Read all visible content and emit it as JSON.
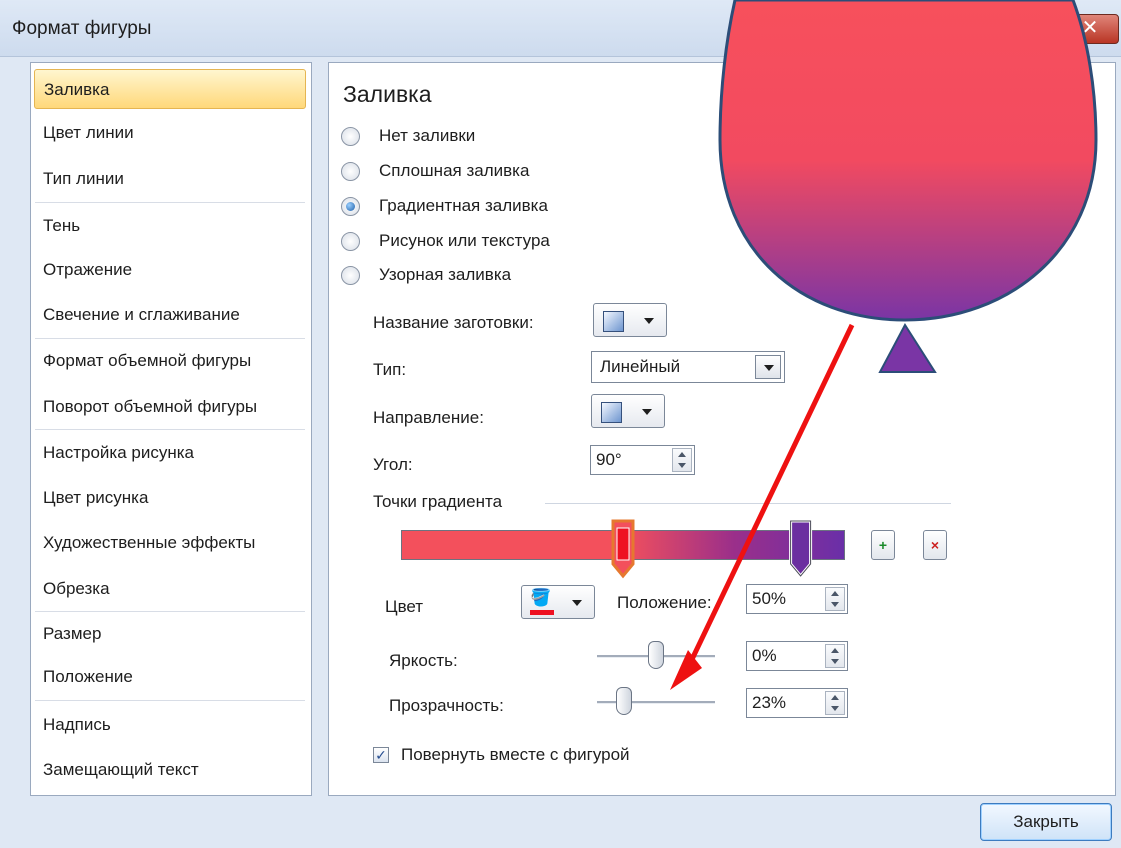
{
  "window": {
    "title": "Формат фигуры",
    "help_label": "?",
    "close_label": "✕"
  },
  "sidebar": {
    "items": [
      {
        "label": "Заливка"
      },
      {
        "label": "Цвет линии"
      },
      {
        "label": "Тип линии"
      },
      {
        "label": "Тень"
      },
      {
        "label": "Отражение"
      },
      {
        "label": "Свечение и сглаживание"
      },
      {
        "label": "Формат объемной фигуры"
      },
      {
        "label": "Поворот объемной фигуры"
      },
      {
        "label": "Настройка рисунка"
      },
      {
        "label": "Цвет рисунка"
      },
      {
        "label": "Художественные эффекты"
      },
      {
        "label": "Обрезка"
      },
      {
        "label": "Размер"
      },
      {
        "label": "Положение"
      },
      {
        "label": "Надпись"
      },
      {
        "label": "Замещающий текст"
      }
    ],
    "selected": "Заливка"
  },
  "fill": {
    "title": "Заливка",
    "options": [
      {
        "label": "Нет заливки",
        "selected": false
      },
      {
        "label": "Сплошная заливка",
        "selected": false
      },
      {
        "label": "Градиентная заливка",
        "selected": true
      },
      {
        "label": "Рисунок или текстура",
        "selected": false
      },
      {
        "label": "Узорная заливка",
        "selected": false
      }
    ],
    "preset_label": "Название заготовки:",
    "type_label": "Тип:",
    "type_value": "Линейный",
    "direction_label": "Направление:",
    "angle_label": "Угол:",
    "angle_value": "90°",
    "stops_label": "Точки градиента",
    "stops": [
      {
        "position": 0.5,
        "color": "#f3505c",
        "selected": true
      },
      {
        "position": 0.9,
        "color": "#7a2fa0",
        "selected": false
      }
    ],
    "add_stop_icon": "add-gradient-stop-icon",
    "remove_stop_icon": "remove-gradient-stop-icon",
    "color_label": "Цвет",
    "position_label": "Положение:",
    "position_value": "50%",
    "brightness_label": "Яркость:",
    "brightness_value": "0%",
    "transparency_label": "Прозрачность:",
    "transparency_value": "23%",
    "rotate_label": "Повернуть вместе с фигурой",
    "rotate_checked": true
  },
  "footer": {
    "close_label": "Закрыть"
  },
  "colors": {
    "shape_top": "#f7505c",
    "shape_bottom": "#7a35a5",
    "arrow": "#ee1111",
    "shape_stroke": "#2c4d78"
  }
}
